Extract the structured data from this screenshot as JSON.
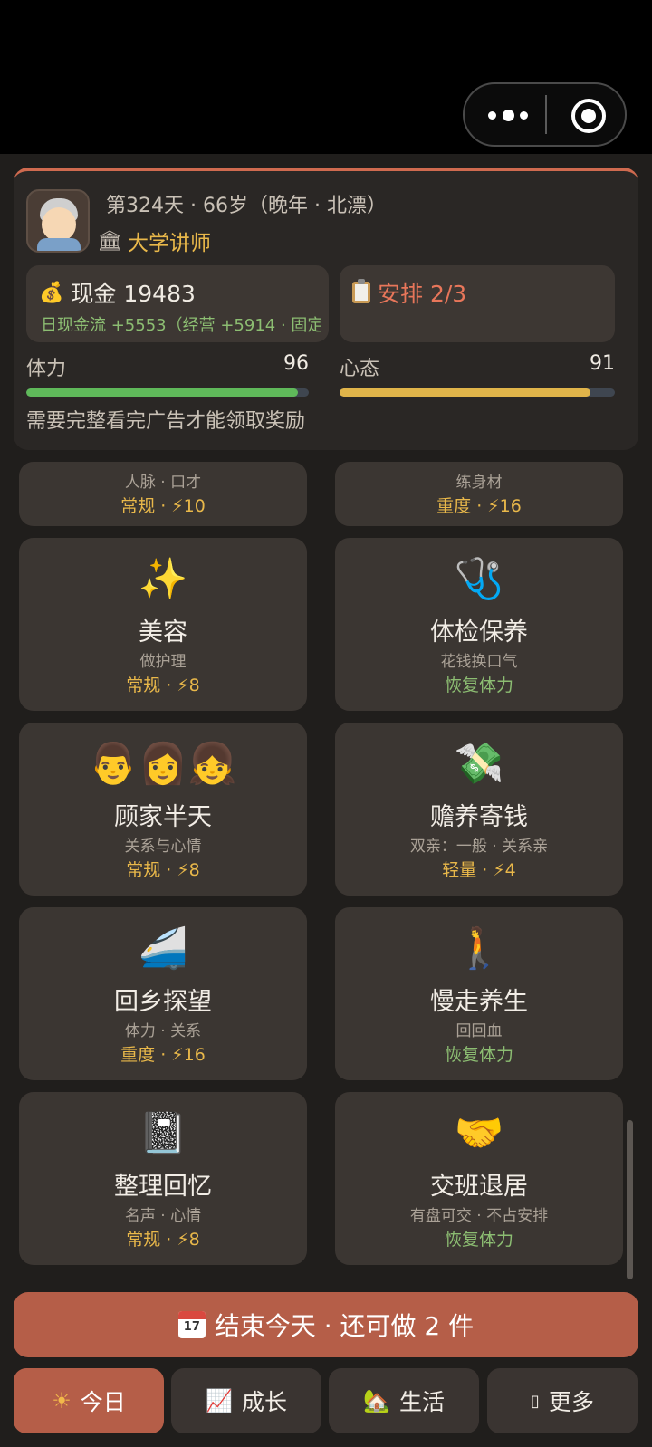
{
  "status": {
    "day_line": "第324天 · 66岁（晚年 · 北漂）",
    "job": "大学讲师",
    "cash_title": "现金 19483",
    "cash_flow": "日现金流 +5553（经营 +5914 · 固定",
    "schedule": "安排 2/3",
    "stamina_label": "体力",
    "stamina_value": "96",
    "stamina_fraction": 0.96,
    "mood_label": "心态",
    "mood_value": "91",
    "mood_fraction": 0.91,
    "notice": "需要完整看完广告才能领取奖励"
  },
  "partial_cards": [
    {
      "desc": "人脉 · 口才",
      "meta": "常规 · ⚡10"
    },
    {
      "desc": "练身材",
      "meta": "重度 · ⚡16"
    }
  ],
  "cards": [
    {
      "icon": "sparkles-icon",
      "emoji": "✨",
      "title": "美容",
      "desc": "做护理",
      "meta": "常规 · ⚡8",
      "meta_kind": "normal"
    },
    {
      "icon": "stethoscope-icon",
      "emoji": "🩺",
      "title": "体检保养",
      "desc": "花钱换口气",
      "meta": "恢复体力",
      "meta_kind": "recover"
    },
    {
      "icon": "family-icon",
      "emoji": "👨👩👧",
      "title": "顾家半天",
      "desc": "关系与心情",
      "meta": "常规 · ⚡8",
      "meta_kind": "normal"
    },
    {
      "icon": "money-with-wings-icon",
      "emoji": "💸",
      "title": "赡养寄钱",
      "desc": "双亲：一般 · 关系亲",
      "meta": "轻量 · ⚡4",
      "meta_kind": "normal"
    },
    {
      "icon": "bullet-train-icon",
      "emoji": "🚄",
      "title": "回乡探望",
      "desc": "体力 · 关系",
      "meta": "重度 · ⚡16",
      "meta_kind": "normal"
    },
    {
      "icon": "walking-person-icon",
      "emoji": "🚶",
      "title": "慢走养生",
      "desc": "回回血",
      "meta": "恢复体力",
      "meta_kind": "recover"
    },
    {
      "icon": "notebook-icon",
      "emoji": "📓",
      "title": "整理回忆",
      "desc": "名声 · 心情",
      "meta": "常规 · ⚡8",
      "meta_kind": "normal"
    },
    {
      "icon": "handshake-icon",
      "emoji": "🤝",
      "title": "交班退居",
      "desc": "有盘可交 · 不占安排",
      "meta": "恢复体力",
      "meta_kind": "recover"
    }
  ],
  "end_button": {
    "cal_text": "17",
    "label": "结束今天 · 还可做 2 件"
  },
  "tabs": [
    {
      "icon": "sun-icon",
      "glyph": "☀",
      "label": "今日",
      "active": true
    },
    {
      "icon": "chart-increasing-icon",
      "glyph": "📈",
      "label": "成长",
      "active": false
    },
    {
      "icon": "house-icon",
      "glyph": "🏡",
      "label": "生活",
      "active": false
    },
    {
      "icon": "more-icon",
      "glyph": "▯",
      "label": "更多",
      "active": false
    }
  ],
  "colors": {
    "accent": "#b55e48",
    "stamina_bar": "#5fb95a",
    "mood_bar": "#e0b44a",
    "highlight_gold": "#e9b84a",
    "recover_green": "#8cbd72"
  }
}
